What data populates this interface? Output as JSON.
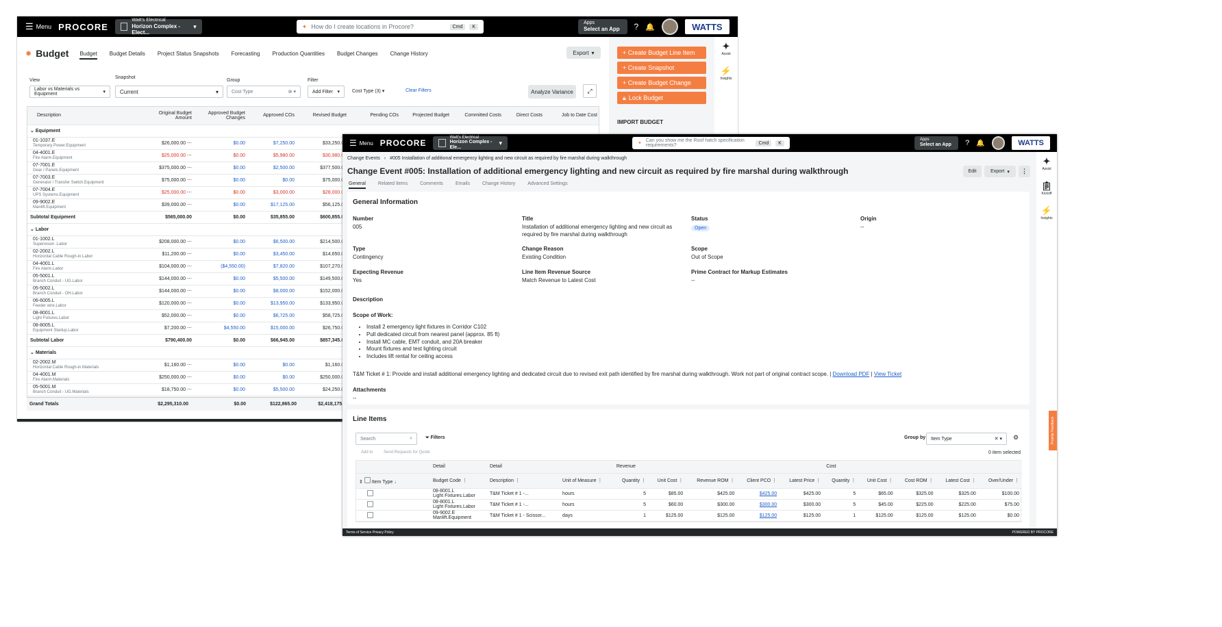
{
  "back": {
    "menu": "Menu",
    "logo": "PROCORE",
    "company": "Watt's Electrical",
    "project": "Horizon Complex - Elect...",
    "search_placeholder": "How do I create locations in Procore?",
    "kbd1": "Cmd",
    "kbd2": "K",
    "apps_label": "Apps",
    "apps_value": "Select an App",
    "brand": "WATTS",
    "title": "Budget",
    "tabs": [
      "Budget",
      "Budget Details",
      "Project Status Snapshots",
      "Forecasting",
      "Production Quantities",
      "Budget Changes",
      "Change History"
    ],
    "export": "Export",
    "view_label": "View",
    "view_value": "Labor vs Materials vs Equipment",
    "snapshot_label": "Snapshot",
    "snapshot_value": "Current",
    "group_label": "Group",
    "group_value": "Cost Type",
    "filter_label": "Filter",
    "add_filter": "Add Filter",
    "cost_type": "Cost Type (3)",
    "clear": "Clear Filters",
    "analyze": "Analyze Variance",
    "actions": [
      "+ Create Budget Line Item",
      "+ Create Snapshot",
      "+ Create Budget Change",
      "Lock Budget"
    ],
    "import": "IMPORT BUDGET",
    "rail": [
      "Assist",
      "Insights"
    ],
    "columns": [
      "Description",
      "Original Budget Amount",
      "Approved Budget Changes",
      "Approved COs",
      "Revised Budget",
      "Pending COs",
      "Projected Budget",
      "Committed Costs",
      "Direct Costs",
      "Job to Date Cost"
    ],
    "groups": [
      {
        "name": "Equipment",
        "rows": [
          {
            "code": "01-1037.E",
            "desc": "Temporary Power.Equipment",
            "orig": "$26,000.00",
            "abc": "$0.00",
            "aco": "$7,250.00",
            "rev": "$33,250.00",
            "neg": false
          },
          {
            "code": "04-4001.E",
            "desc": "Fire Alarm.Equipment",
            "orig": "$25,000.00",
            "abc": "$0.00",
            "aco": "$5,980.00",
            "rev": "$30,980.00",
            "neg": true
          },
          {
            "code": "07-7001.E",
            "desc": "Gear / Panels.Equipment",
            "orig": "$375,000.00",
            "abc": "$0.00",
            "aco": "$2,500.00",
            "rev": "$377,500.00",
            "neg": false
          },
          {
            "code": "07-7003.E",
            "desc": "Generator / Transfer Switch.Equipment",
            "orig": "$75,000.00",
            "abc": "$0.00",
            "aco": "$0.00",
            "rev": "$75,000.00",
            "neg": false
          },
          {
            "code": "07-7004.E",
            "desc": "UPS Systems.Equipment",
            "orig": "$25,000.00",
            "abc": "$0.00",
            "aco": "$3,000.00",
            "rev": "$28,000.00",
            "neg": true
          },
          {
            "code": "09-9002.E",
            "desc": "Manlift.Equipment",
            "orig": "$39,000.00",
            "abc": "$0.00",
            "aco": "$17,125.00",
            "rev": "$56,125.00",
            "neg": false
          }
        ],
        "subtotal": {
          "label": "Subtotal Equipment",
          "orig": "$565,000.00",
          "abc": "$0.00",
          "aco": "$35,855.00",
          "rev": "$600,855.00"
        }
      },
      {
        "name": "Labor",
        "rows": [
          {
            "code": "01-1002.L",
            "desc": "Supervision .Labor",
            "orig": "$208,000.00",
            "abc": "$0.00",
            "aco": "$6,500.00",
            "rev": "$214,500.00",
            "neg": false
          },
          {
            "code": "02-2002.L",
            "desc": "Horizontal Cable Rough-in.Labor",
            "orig": "$11,200.00",
            "abc": "$0.00",
            "aco": "$3,450.00",
            "rev": "$14,650.00",
            "neg": false
          },
          {
            "code": "04-4001.L",
            "desc": "Fire Alarm.Labor",
            "orig": "$104,000.00",
            "abc": "($4,550.00)",
            "aco": "$7,820.00",
            "rev": "$107,270.00",
            "neg": false
          },
          {
            "code": "05-5001.L",
            "desc": "Branch Conduit - UG.Labor",
            "orig": "$144,000.00",
            "abc": "$0.00",
            "aco": "$5,500.00",
            "rev": "$149,500.00",
            "neg": false
          },
          {
            "code": "05-5002.L",
            "desc": "Branch Conduit - OH.Labor",
            "orig": "$144,000.00",
            "abc": "$0.00",
            "aco": "$8,000.00",
            "rev": "$152,000.00",
            "neg": false
          },
          {
            "code": "06-6005.L",
            "desc": "Feeder wire.Labor",
            "orig": "$120,000.00",
            "abc": "$0.00",
            "aco": "$13,950.00",
            "rev": "$133,950.00",
            "neg": false
          },
          {
            "code": "08-8001.L",
            "desc": "Light Fixtures.Labor",
            "orig": "$52,000.00",
            "abc": "$0.00",
            "aco": "$6,725.00",
            "rev": "$58,725.00",
            "neg": false
          },
          {
            "code": "08-8005.L",
            "desc": "Equipment Startup.Labor",
            "orig": "$7,200.00",
            "abc": "$4,550.00",
            "aco": "$15,000.00",
            "rev": "$26,750.00",
            "neg": false
          }
        ],
        "subtotal": {
          "label": "Subtotal Labor",
          "orig": "$790,400.00",
          "abc": "$0.00",
          "aco": "$66,945.00",
          "rev": "$857,345.00"
        }
      },
      {
        "name": "Materials",
        "rows": [
          {
            "code": "02-2002.M",
            "desc": "Horizontal Cable Rough-in.Materials",
            "orig": "$1,160.00",
            "abc": "$0.00",
            "aco": "$0.00",
            "rev": "$1,160.00",
            "neg": false
          },
          {
            "code": "04-4001.M",
            "desc": "Fire Alarm.Materials",
            "orig": "$250,000.00",
            "abc": "$0.00",
            "aco": "$0.00",
            "rev": "$250,000.00",
            "neg": false
          },
          {
            "code": "05-5001.M",
            "desc": "Branch Conduit - UG.Materials",
            "orig": "$18,750.00",
            "abc": "$0.00",
            "aco": "$5,500.00",
            "rev": "$24,250.00",
            "neg": false
          }
        ]
      }
    ],
    "grand": {
      "label": "Grand Totals",
      "orig": "$2,295,310.00",
      "abc": "$0.00",
      "aco": "$122,865.00",
      "rev": "$2,418,175.00"
    }
  },
  "front": {
    "menu": "Menu",
    "logo": "PROCORE",
    "company": "Watt's Electrical",
    "project": "Horizon Complex - Ele...",
    "search_placeholder": "Can you show me the Roof hatch specification requirements?",
    "kbd1": "Cmd",
    "kbd2": "K",
    "apps_label": "Apps",
    "apps_value": "Select an App",
    "brand": "WATTS",
    "crumb1": "Change Events",
    "crumb2": "#005 Installation of additional emergency lighting and new circuit as required by fire marshal during walkthrough",
    "title": "Change Event #005: Installation of additional emergency lighting and new circuit as required by fire marshal during walkthrough",
    "edit": "Edit",
    "export": "Export",
    "tabs": [
      "General",
      "Related Items",
      "Comments",
      "Emails",
      "Change History",
      "Advanced Settings"
    ],
    "gi_title": "General Information",
    "fields": {
      "number_l": "Number",
      "number_v": "005",
      "title_l": "Title",
      "title_v": "Installation of additional emergency lighting and new circuit as required by fire marshal during walkthrough",
      "status_l": "Status",
      "status_v": "Open",
      "origin_l": "Origin",
      "origin_v": "--",
      "type_l": "Type",
      "type_v": "Contingency",
      "reason_l": "Change Reason",
      "reason_v": "Existing Condition",
      "scope_l": "Scope",
      "scope_v": "Out of Scope",
      "exp_l": "Expecting Revenue",
      "exp_v": "Yes",
      "src_l": "Line Item Revenue Source",
      "src_v": "Match Revenue to Latest Cost",
      "pc_l": "Prime Contract for Markup Estimates",
      "pc_v": "--",
      "desc_l": "Description",
      "sow": "Scope of Work:",
      "bullets": [
        "Install 2 emergency light fixtures in Corridor C102",
        "Pull dedicated circuit from nearest panel (approx. 85 ft)",
        "Install MC cable, EMT conduit, and 20A breaker",
        "Mount fixtures and test lighting circuit",
        "Includes lift rental for ceiling access"
      ],
      "tm": "T&M Ticket # 1: Provide and install additional emergency lighting and dedicated circuit due to revised exit path identified by fire marshal during walkthrough. Work not part of original contract scope. |",
      "pdf": "Download PDF",
      "sep": "|",
      "ticket": "View Ticket",
      "att_l": "Attachments",
      "att_v": "--"
    },
    "li_title": "Line Items",
    "li_search": "Search",
    "filters": "Filters",
    "groupby_l": "Group by",
    "groupby_v": "Item Type",
    "add_to": "Add to",
    "send": "Send Requests for Quote",
    "count": "0 item selected",
    "groups": [
      "Detail",
      "Detail",
      "Revenue",
      "Cost"
    ],
    "cols": [
      "Item Type",
      "Budget Code",
      "Description",
      "Unit of Measure",
      "Quantity",
      "Unit Cost",
      "Revenue ROM",
      "Client PCO",
      "Latest Price",
      "Quantity",
      "Unit Cost",
      "Cost ROM",
      "Latest Cost",
      "Over/Under"
    ],
    "rows": [
      [
        "08-8001.L",
        "Light Fixtures.Labor",
        "T&M Ticket # 1 -...",
        "hours",
        "5",
        "$85.00",
        "$425.00",
        "$425.00",
        "$425.00",
        "5",
        "$65.00",
        "$325.00",
        "$325.00",
        "$100.00"
      ],
      [
        "08-8001.L",
        "Light Fixtures.Labor",
        "T&M Ticket # 1 -...",
        "hours",
        "5",
        "$60.00",
        "$300.00",
        "$300.00",
        "$300.00",
        "5",
        "$45.00",
        "$225.00",
        "$225.00",
        "$75.00"
      ],
      [
        "09-9002.E",
        "Manlift.Equipment",
        "T&M Ticket # 1 - Scissor...",
        "days",
        "1",
        "$125.00",
        "$125.00",
        "$125.00",
        "$125.00",
        "1",
        "$125.00",
        "$125.00",
        "$125.00",
        "$0.00"
      ]
    ],
    "rail": [
      "Assist",
      "Kickoff",
      "Insights"
    ],
    "feedback": "Provide Feedback",
    "footer_l": "Terms of Service  Privacy Policy",
    "footer_r": "POWERED BY PROCORE"
  }
}
